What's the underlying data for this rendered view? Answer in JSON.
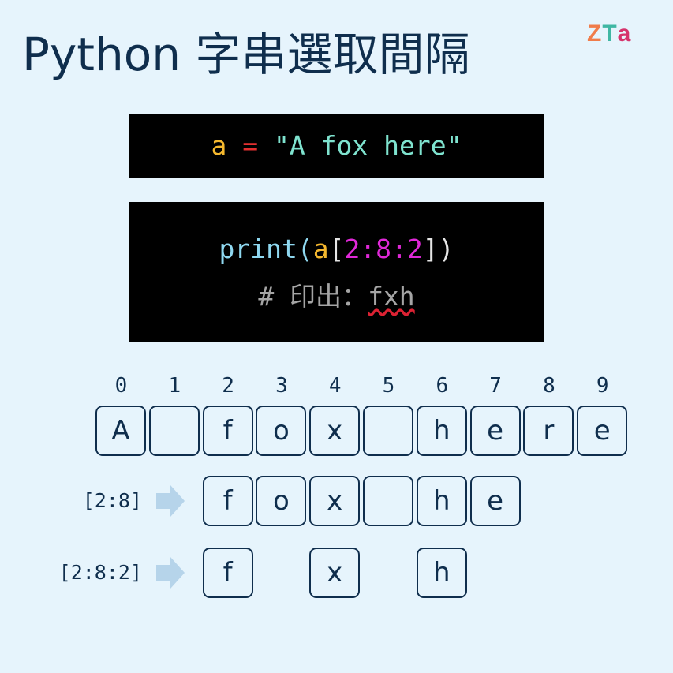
{
  "title": "Python 字串選取間隔",
  "logo": {
    "letters": [
      "Z",
      "T",
      "a"
    ],
    "colors": [
      "#f07c4a",
      "#3fb7a3",
      "#d6336c"
    ]
  },
  "code_block_1": {
    "var": "a",
    "op": " = ",
    "str": "\"A fox here\"",
    "colors": {
      "var": "#f5b82e",
      "op": "#e23030",
      "str": "#7fe3cf"
    }
  },
  "code_block_2": {
    "func": "print(",
    "var": "a",
    "open": "[",
    "slice": "2:8:2",
    "close": "])",
    "comment_prefix": "# 印出：",
    "comment_value": "fxh",
    "colors": {
      "func": "#8fd8f0",
      "var": "#f5b82e",
      "bracket": "#e5e5e5",
      "slice": "#e028d8"
    }
  },
  "indices": [
    "0",
    "1",
    "2",
    "3",
    "4",
    "5",
    "6",
    "7",
    "8",
    "9"
  ],
  "chars": [
    "A",
    "",
    "f",
    "o",
    "x",
    "",
    "h",
    "e",
    "r",
    "e"
  ],
  "rows": [
    {
      "label": "[2:8]",
      "cells": [
        {
          "pos": 2,
          "ch": "f"
        },
        {
          "pos": 3,
          "ch": "o"
        },
        {
          "pos": 4,
          "ch": "x"
        },
        {
          "pos": 5,
          "ch": ""
        },
        {
          "pos": 6,
          "ch": "h"
        },
        {
          "pos": 7,
          "ch": "e"
        }
      ]
    },
    {
      "label": "[2:8:2]",
      "cells": [
        {
          "pos": 2,
          "ch": "f"
        },
        {
          "pos": 4,
          "ch": "x"
        },
        {
          "pos": 6,
          "ch": "h"
        }
      ]
    }
  ],
  "arrow_color": "#b6d4ea"
}
